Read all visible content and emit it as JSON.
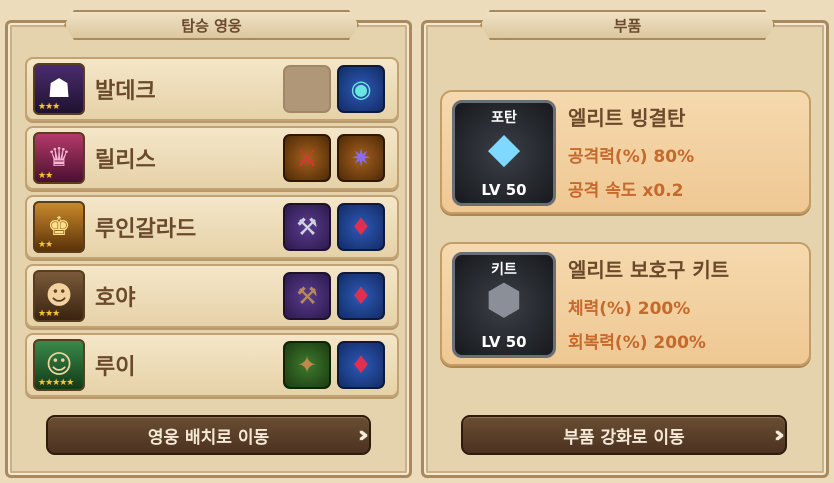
{
  "left_panel": {
    "title": "탑승 영웅",
    "heroes": [
      {
        "name": "발데크",
        "stars": "★★★",
        "equip": [
          "",
          "amulet-icon"
        ]
      },
      {
        "name": "릴리스",
        "stars": "★★",
        "equip": [
          "scythe-icon",
          "claw-icon"
        ]
      },
      {
        "name": "루인갈라드",
        "stars": "★★",
        "equip": [
          "axe-icon",
          "amulet-icon"
        ]
      },
      {
        "name": "호야",
        "stars": "★★★",
        "equip": [
          "hammer-icon",
          "amulet-icon"
        ]
      },
      {
        "name": "루이",
        "stars": "★★★★★",
        "equip": [
          "pistol-icon",
          "amulet-icon"
        ]
      }
    ],
    "button": "영웅 배치로 이동"
  },
  "right_panel": {
    "title": "부품",
    "parts": [
      {
        "type": "포탄",
        "level": "LV 50",
        "name": "엘리트 빙결탄",
        "stat1": "공격력(%) 80%",
        "stat2": "공격 속도 x0.2",
        "art": "ice-crystal-icon"
      },
      {
        "type": "키트",
        "level": "LV 50",
        "name": "엘리트 보호구 키트",
        "stat1": "체력(%) 200%",
        "stat2": "회복력(%) 200%",
        "art": "armor-plate-icon"
      }
    ],
    "button": "부품 강화로 이동"
  },
  "colors": {
    "background": "#ecdcbc",
    "text_brown": "#6b4a2b",
    "stat_orange": "#c5692c",
    "button_dark": "#4b3220"
  }
}
